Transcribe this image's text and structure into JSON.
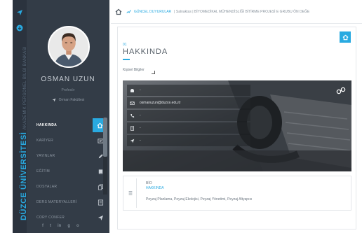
{
  "sidebar": {
    "vertical_title": "DÜZCE ÜNİVERSİTESİ",
    "vertical_subtitle": "AKADEMİK PERSONEL BİLGİ BANKASI",
    "profile": {
      "name": "OSMAN UZUN",
      "title": "Profesör",
      "faculty": "Orman Fakültesi"
    },
    "menu": [
      {
        "label": "HAKKINDA",
        "icon": "home-icon",
        "active": true
      },
      {
        "label": "KARİYER",
        "icon": "id-card-icon",
        "active": false
      },
      {
        "label": "YAYINLAR",
        "icon": "pencil-icon",
        "active": false
      },
      {
        "label": "EĞİTİM",
        "icon": "book-icon",
        "active": false
      },
      {
        "label": "DOSYALAR",
        "icon": "files-icon",
        "active": false
      },
      {
        "label": "DERS MATERYALLERİ",
        "icon": "document-icon",
        "active": false
      },
      {
        "label": "CORY CONFER",
        "icon": "send-icon",
        "active": false
      }
    ],
    "social": [
      "f",
      "t",
      "in",
      "g",
      "o"
    ]
  },
  "breadcrumb": {
    "link": "GÜNCEL DUYURULAR",
    "text": "| Salnaktas | BİYOMEDİKAL MÜHENDİSLİĞİ BİTİRME PROJESİ E GRUBU ÖN DEĞE"
  },
  "section": {
    "number": "01",
    "title": "HAKKINDA"
  },
  "personal_label": "Kişisel Bilgiler",
  "info_rows": [
    {
      "icon": "phone-icon",
      "value": "-"
    },
    {
      "icon": "email-icon",
      "value": "osmanuzun@duzce.edu.tr"
    },
    {
      "icon": "phone-icon",
      "value": "-"
    },
    {
      "icon": "fax-icon",
      "value": "-"
    },
    {
      "icon": "location-icon",
      "value": "-"
    }
  ],
  "bio": {
    "label": "BİO",
    "sublabel": "HAKKINDA",
    "text": "Peyzaj Planlama, Peyzaj Ekolojisi, Peyzaj Yönetimi, Peyzaj Altyapısı"
  },
  "colors": {
    "accent": "#29aae1",
    "sidebar": "#333c47",
    "rail": "#2b333e"
  }
}
